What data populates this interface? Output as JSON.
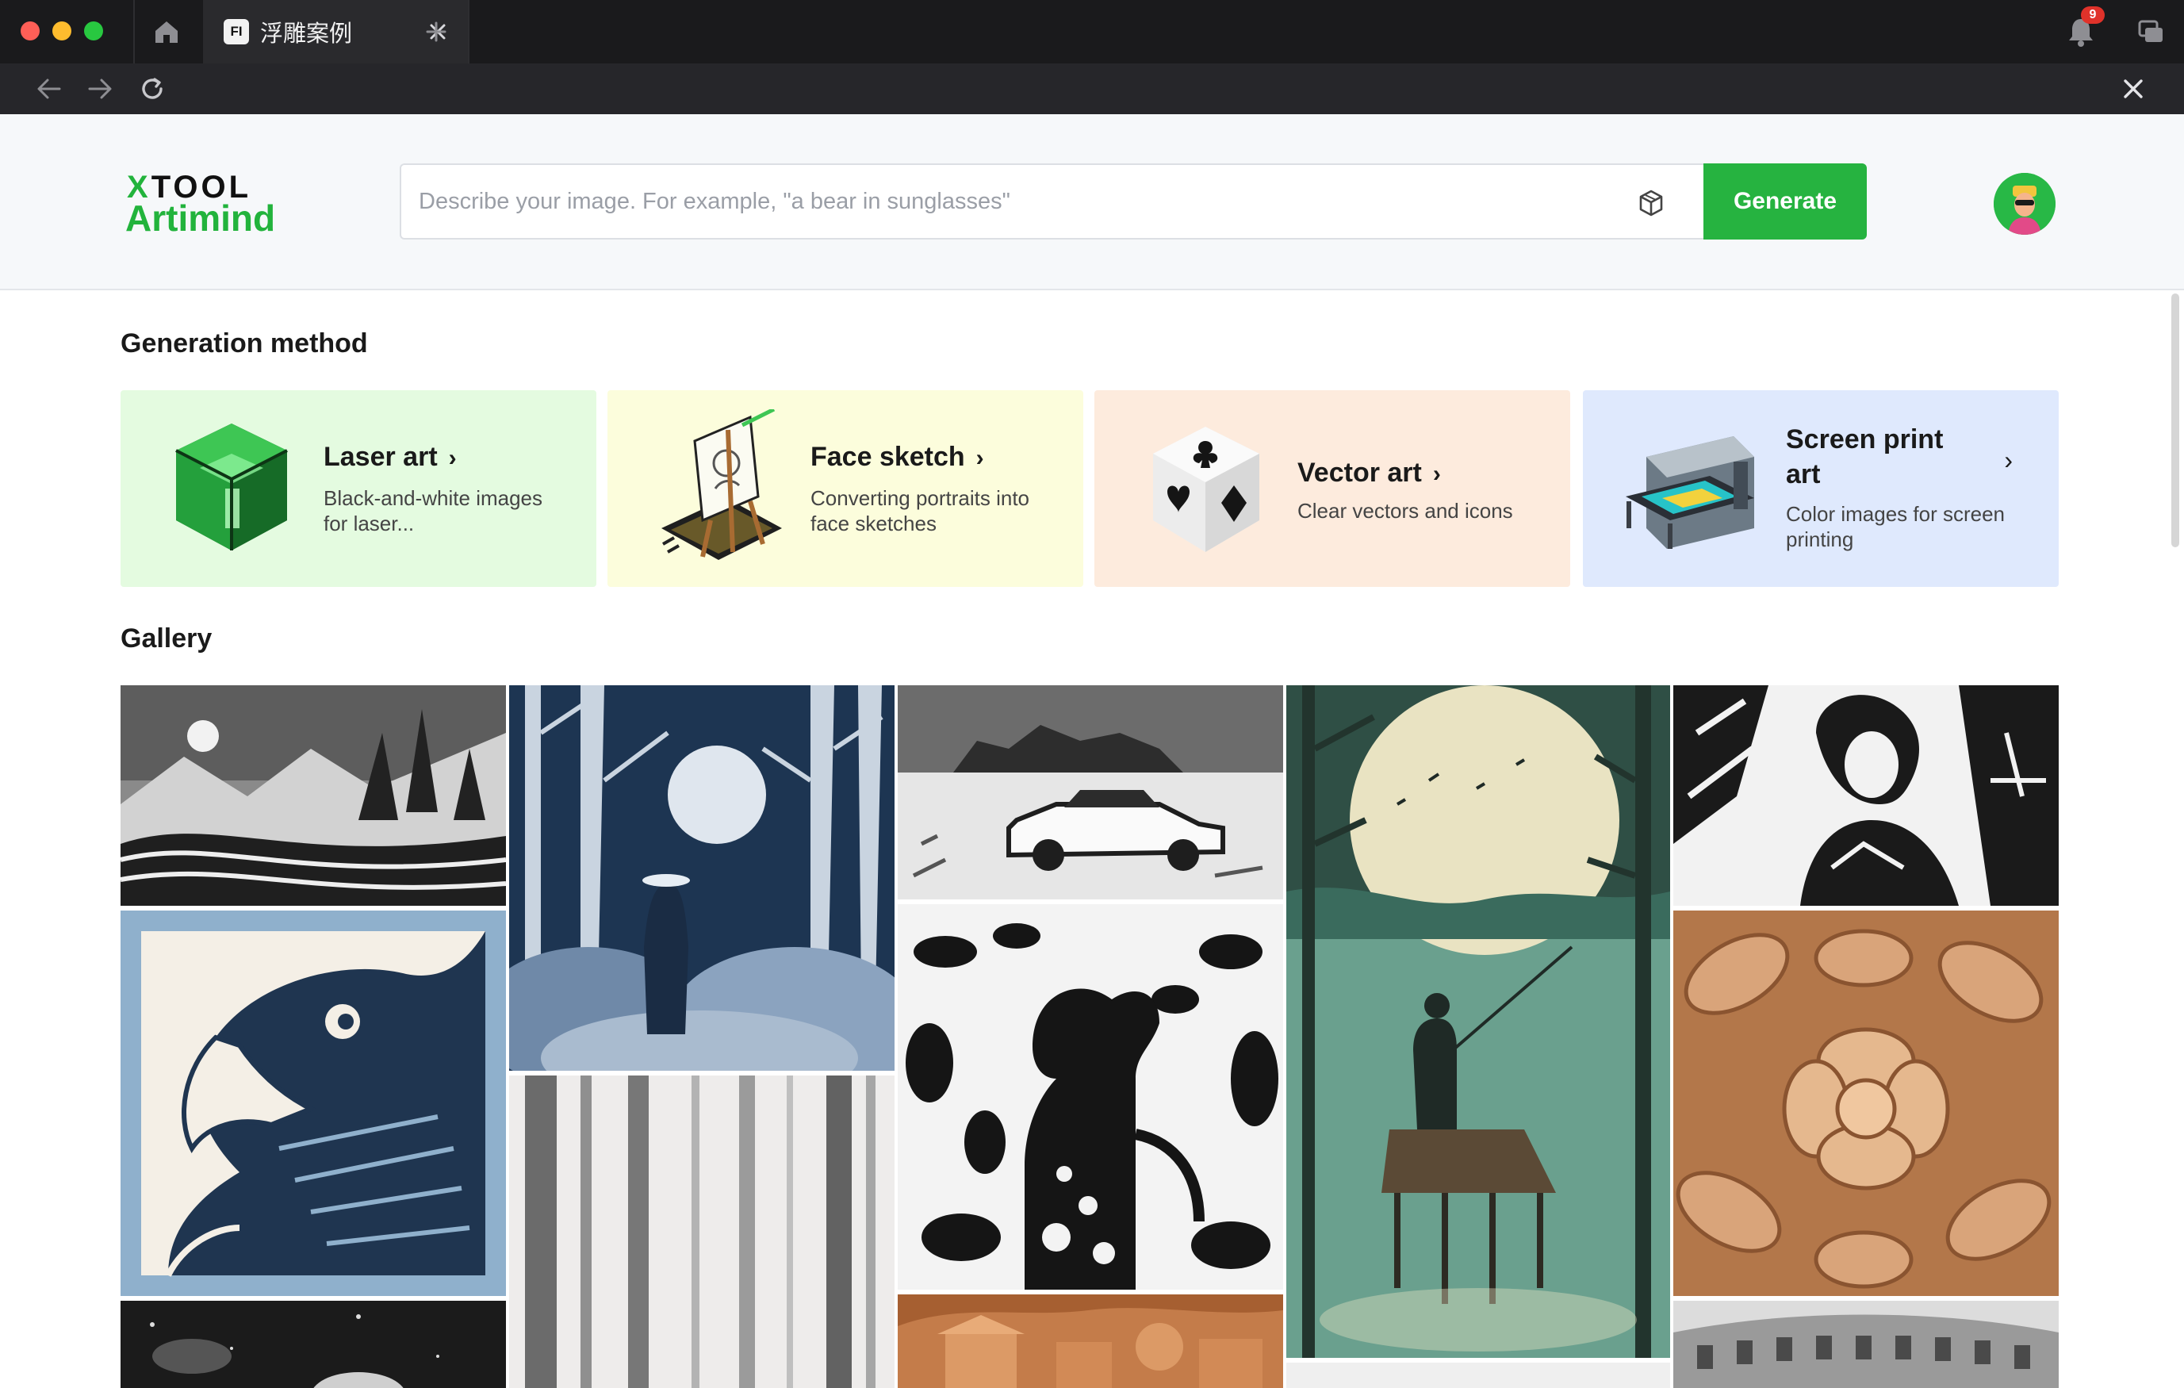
{
  "window": {
    "tab_favicon": "FI",
    "tab_title": "浮雕案例",
    "notification_count": "9"
  },
  "brand": {
    "logo_prefix": "X",
    "logo_word": "TOOL",
    "product": "Artimind",
    "accent_color": "#26b340"
  },
  "search": {
    "placeholder": "Describe your image. For example, \"a bear in sunglasses\"",
    "value": "",
    "generate_label": "Generate"
  },
  "generation_method": {
    "title": "Generation method",
    "items": [
      {
        "title": "Laser art",
        "desc": "Black-and-white images for laser...",
        "bg": "#e4fbe0"
      },
      {
        "title": "Face sketch",
        "desc": "Converting portraits into face sketches",
        "bg": "#fcfddc"
      },
      {
        "title": "Vector art",
        "desc": "Clear vectors and icons",
        "bg": "#fdebdd"
      },
      {
        "title": "Screen print art",
        "desc": "Color images for screen printing",
        "bg": "#dfe9fd"
      }
    ]
  },
  "gallery": {
    "title": "Gallery"
  },
  "icons": {
    "home": "home-icon",
    "close": "close-icon",
    "plus": "plus-icon",
    "bell": "bell-icon",
    "windows": "windows-icon",
    "back": "arrow-left-icon",
    "forward": "arrow-right-icon",
    "reload": "reload-icon",
    "cube": "cube-icon",
    "chevron": "chevron-right-icon"
  }
}
